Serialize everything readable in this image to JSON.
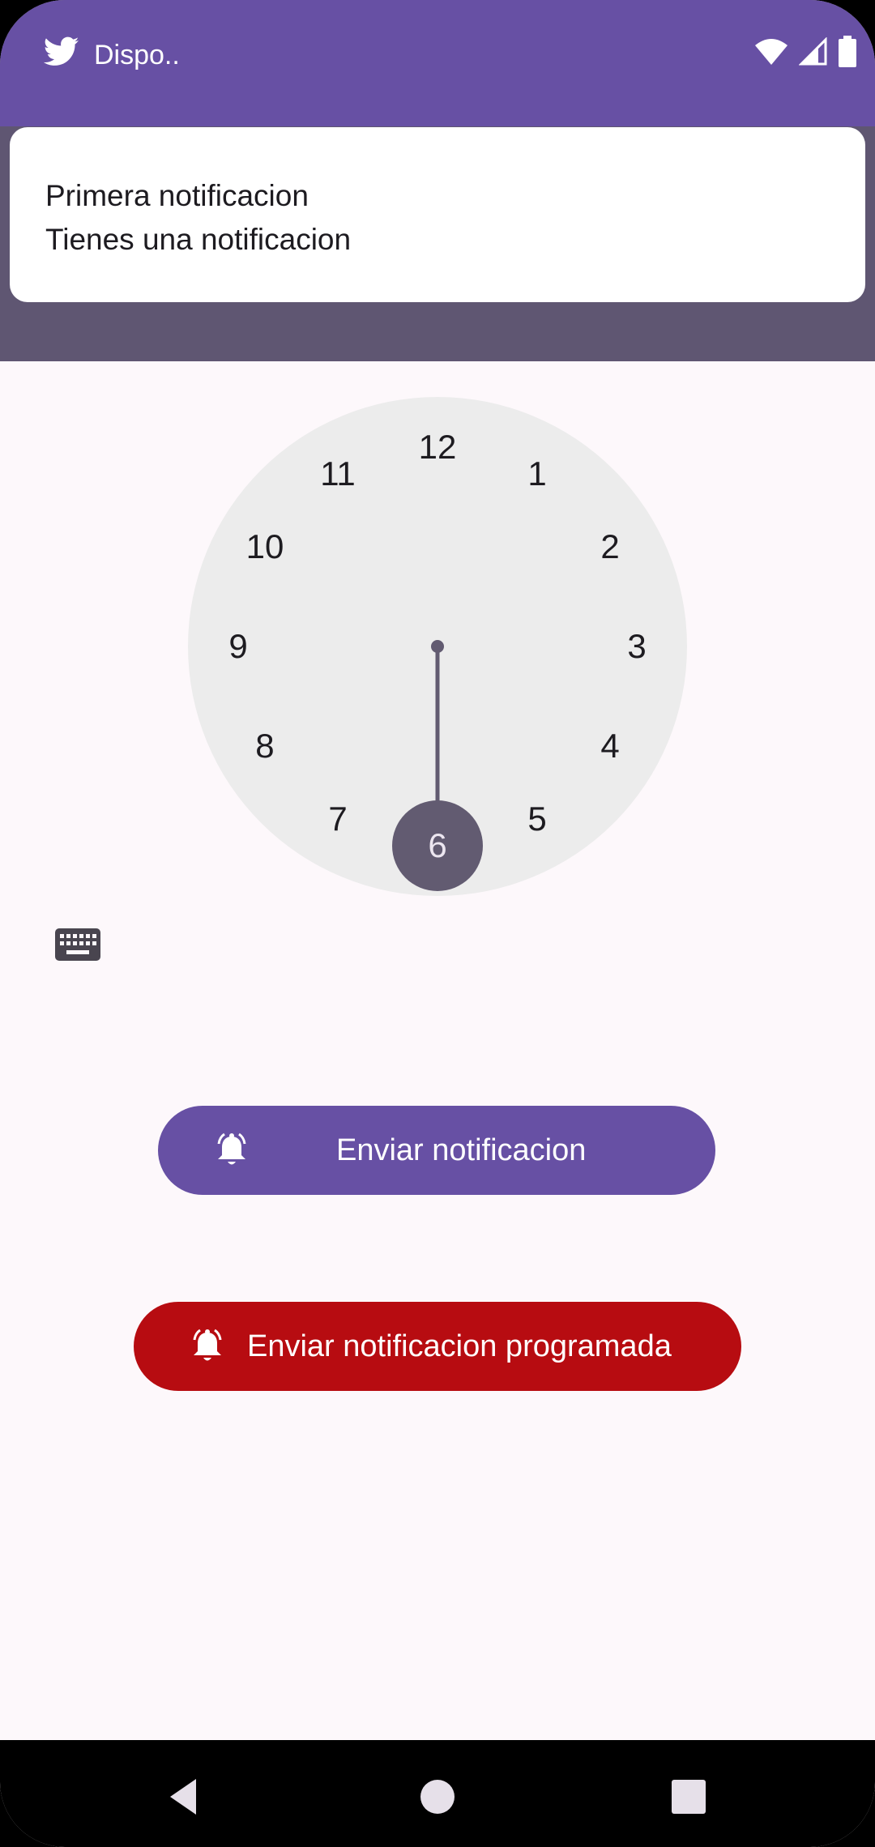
{
  "status_bar": {
    "app_name": "Dispo..",
    "app_icon": "twitter-bird-icon",
    "icons": [
      "wifi-icon",
      "cellular-signal-icon",
      "battery-icon"
    ]
  },
  "notification": {
    "title": "Primera notificacion",
    "text": "Tienes una notificacion"
  },
  "clock": {
    "numbers": [
      "12",
      "1",
      "2",
      "3",
      "4",
      "5",
      "6",
      "7",
      "8",
      "9",
      "10",
      "11"
    ],
    "selected_hour": "6"
  },
  "keyboard_toggle": {
    "icon": "keyboard-icon"
  },
  "buttons": {
    "send_label": "Enviar notificacion",
    "scheduled_label": "Enviar notificacion programada",
    "icon": "alarm-bell-icon"
  },
  "nav_bar": {
    "items": [
      "back-icon",
      "home-icon",
      "recents-icon"
    ]
  },
  "colors": {
    "status_bar": "#6750a4",
    "scrim": "#5f5672",
    "primary_button": "#6750a4",
    "scheduled_button": "#b70c11",
    "clock_face": "#ececec",
    "clock_hand": "#625b71"
  }
}
